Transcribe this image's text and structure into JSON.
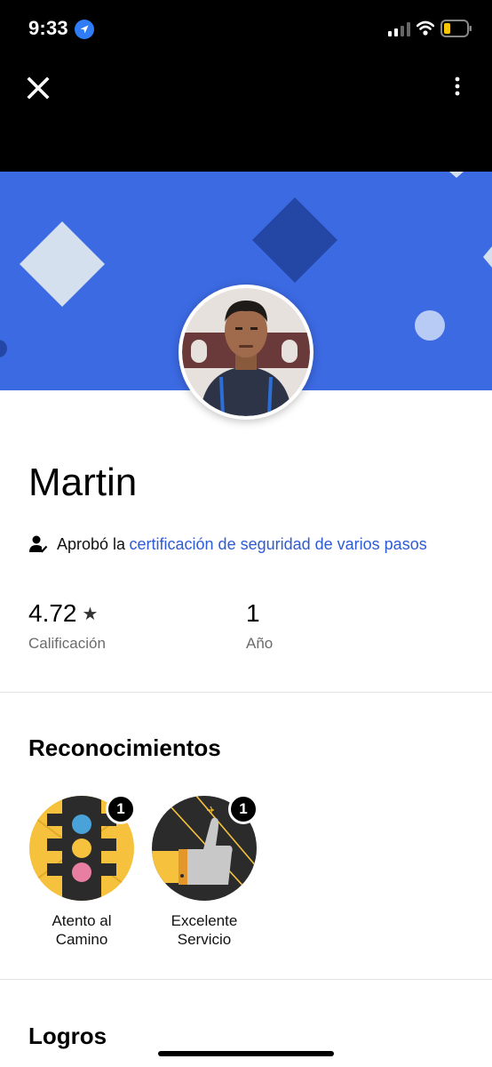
{
  "status_bar": {
    "time": "9:33",
    "icons": [
      "location-arrow-icon",
      "cellular-signal-icon",
      "wifi-icon",
      "battery-low-icon"
    ]
  },
  "top_bar": {
    "close_icon": "close-icon",
    "more_icon": "more-vertical-icon"
  },
  "colors": {
    "banner": "#3c6ae3",
    "link": "#2e5bd6",
    "badge_yellow": "#f6c23d",
    "badge_dark": "#2b2b2b"
  },
  "driver": {
    "name": "Martin",
    "certification_prefix": "Aprobó la",
    "certification_link": "certificación de seguridad de varios pasos"
  },
  "stats": [
    {
      "value": "4.72",
      "label": "Calificación",
      "icon": "star-icon"
    },
    {
      "value": "1",
      "label": "Año"
    }
  ],
  "recognitions": {
    "title": "Reconocimientos",
    "badges": [
      {
        "label_line1": "Atento al",
        "label_line2": "Camino",
        "count": "1",
        "icon": "traffic-light-icon"
      },
      {
        "label_line1": "Excelente",
        "label_line2": "Servicio",
        "count": "1",
        "icon": "thumbs-up-icon"
      }
    ]
  },
  "achievements": {
    "title": "Logros"
  }
}
